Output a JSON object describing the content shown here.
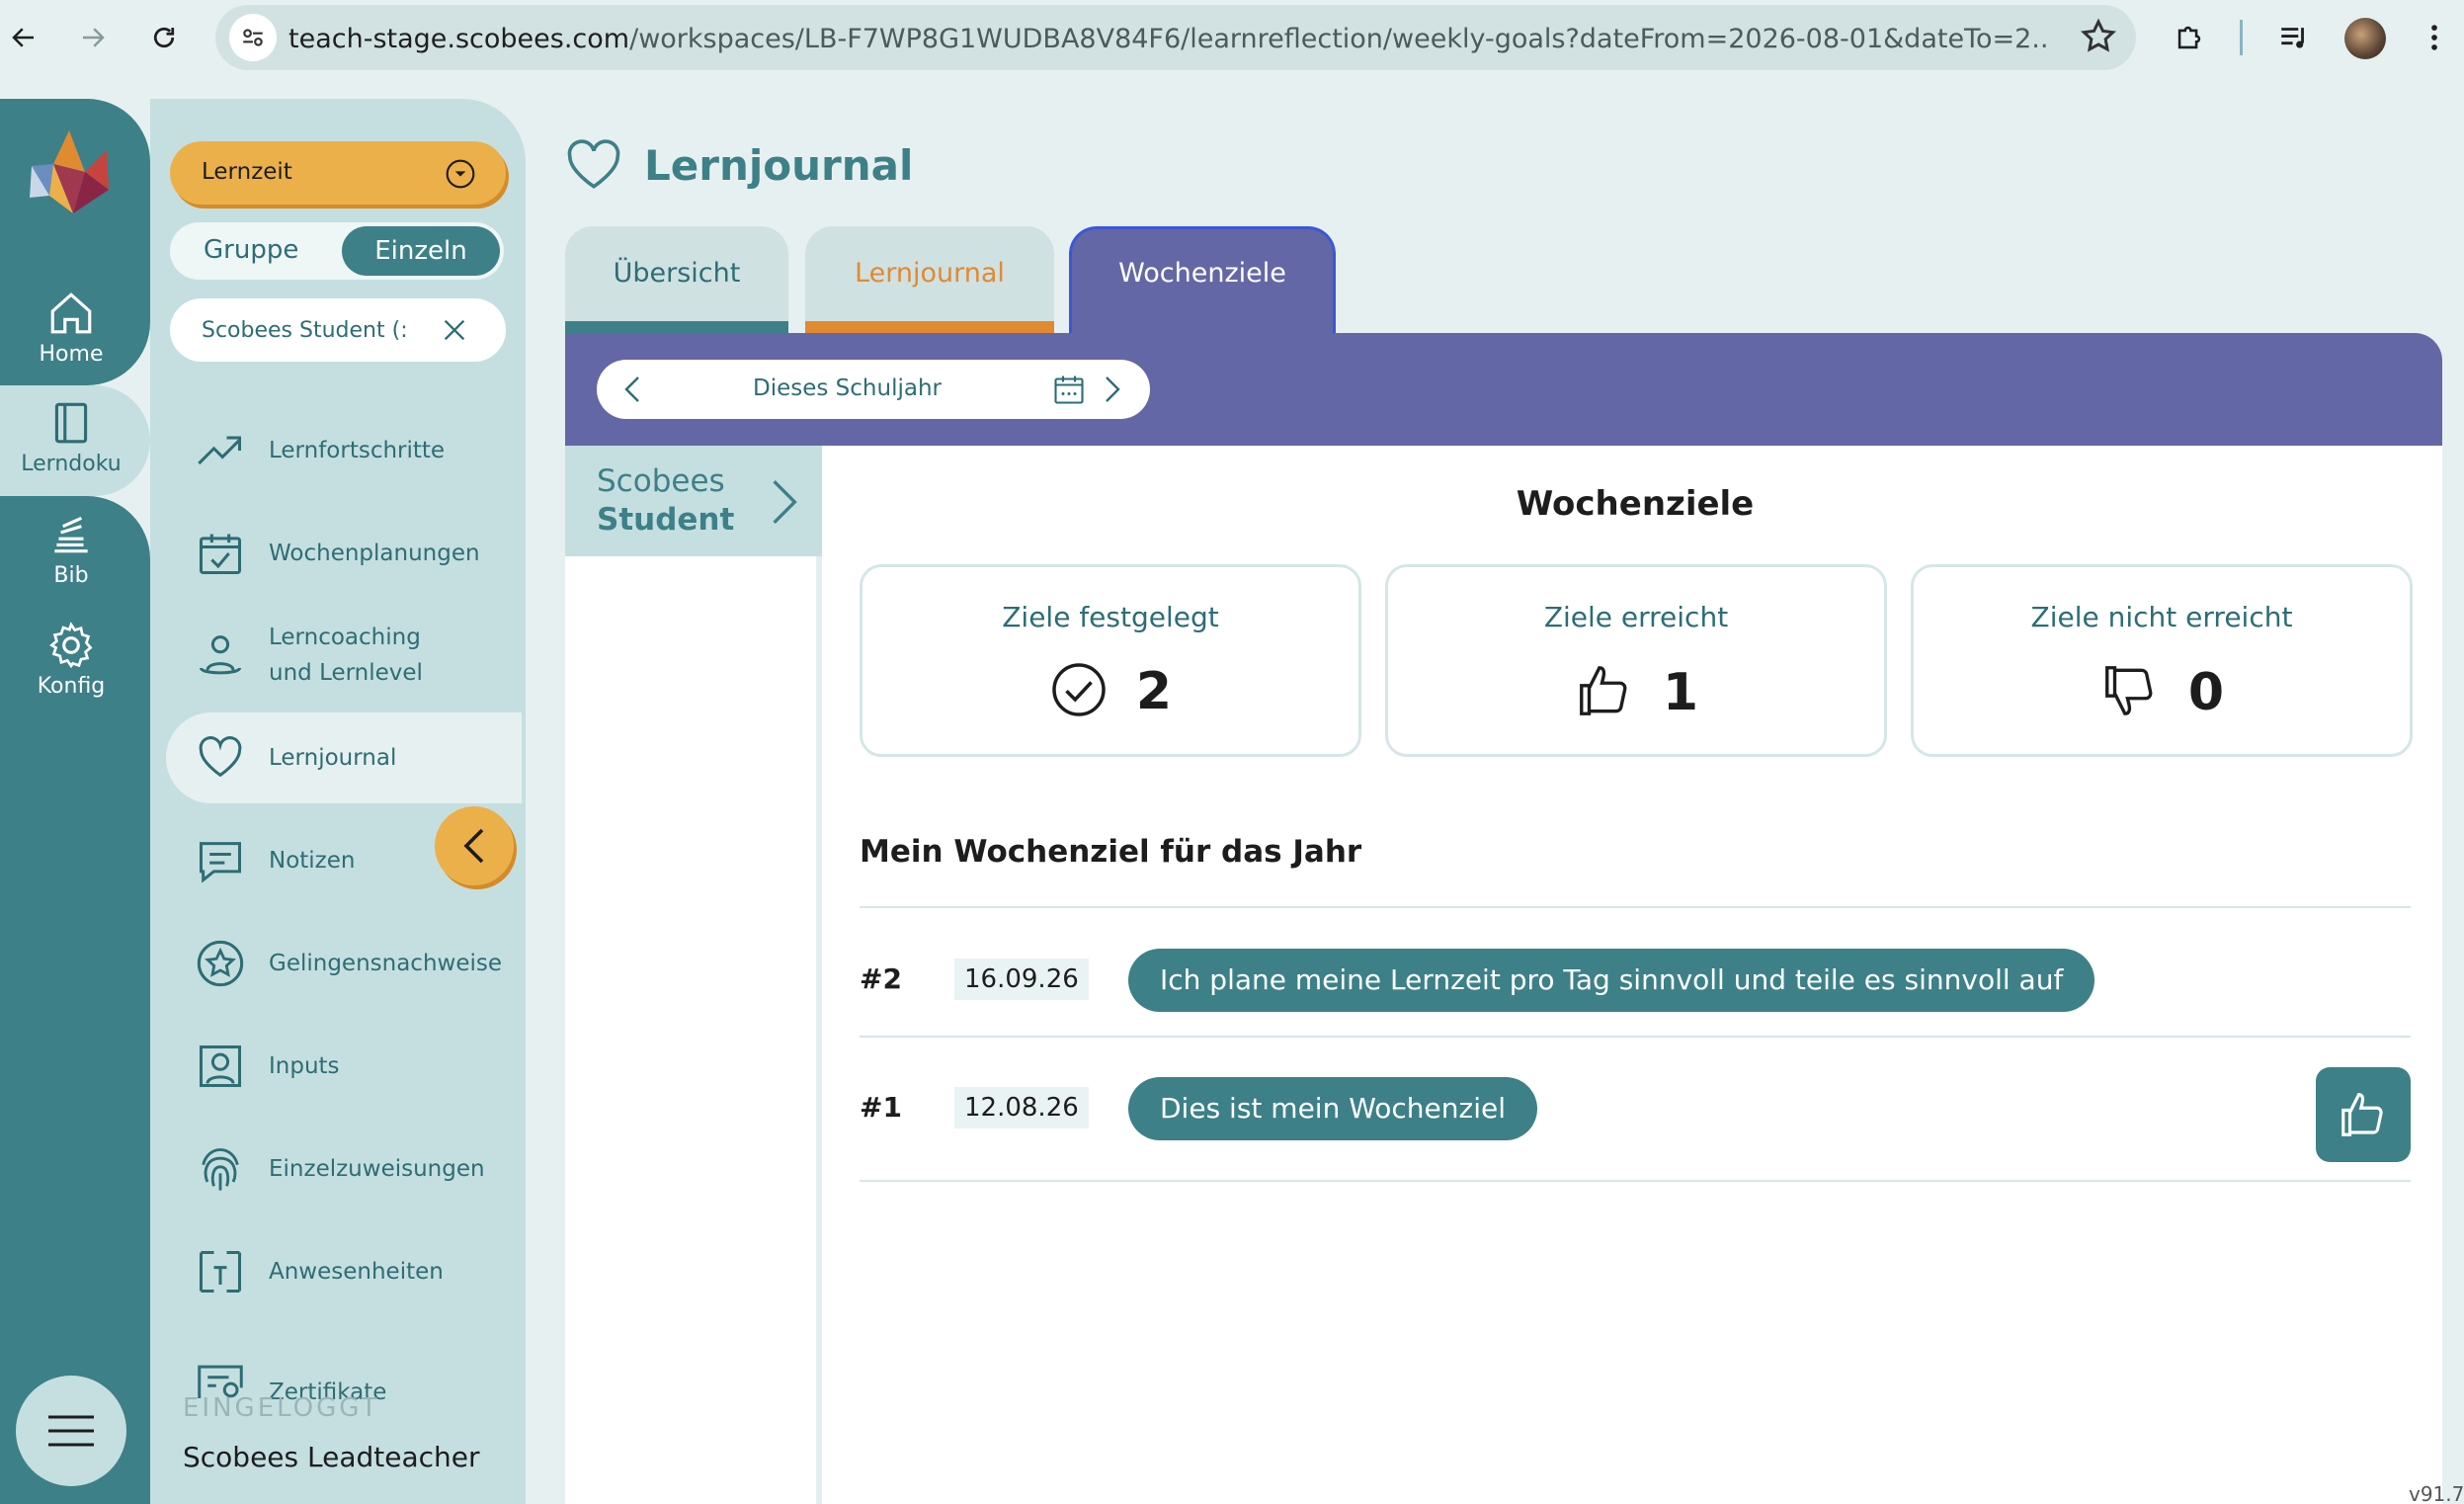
{
  "browser": {
    "url_host": "teach-stage.scobees.com",
    "url_path": "/workspaces/LB-F7WP8G1WUDBA8V84F6/learnreflection/weekly-goals?dateFrom=2026-08-01&dateTo=2..."
  },
  "rail": {
    "items": [
      {
        "label": "Home",
        "icon": "home-icon"
      },
      {
        "label": "Lerndoku",
        "icon": "notebook-icon"
      },
      {
        "label": "Bib",
        "icon": "library-icon"
      },
      {
        "label": "Konfig",
        "icon": "gear-icon"
      }
    ]
  },
  "sidebar": {
    "mode_select": "Lernzeit",
    "segment": {
      "group": "Gruppe",
      "single": "Einzeln"
    },
    "student_chip": "Scobees Student (:",
    "items": [
      {
        "label": "Lernfortschritte",
        "icon": "trend-icon"
      },
      {
        "label": "Wochenplanungen",
        "icon": "calendar-check-icon"
      },
      {
        "label": "Lerncoaching\nund Lernlevel",
        "label_1": "Lerncoaching",
        "label_2": "und Lernlevel",
        "icon": "person-icon"
      },
      {
        "label": "Lernjournal",
        "icon": "heart-icon"
      },
      {
        "label": "Notizen",
        "icon": "comment-icon"
      },
      {
        "label": "Gelingensnachweise",
        "icon": "star-badge-icon"
      },
      {
        "label": "Inputs",
        "icon": "person-frame-icon"
      },
      {
        "label": "Einzelzuweisungen",
        "icon": "fingerprint-icon"
      },
      {
        "label": "Anwesenheiten",
        "icon": "door-icon"
      },
      {
        "label": "Zertifikate",
        "icon": "certificate-icon"
      }
    ],
    "logged_in_label": "EINGELOGGT",
    "logged_in_user": "Scobees Leadteacher"
  },
  "main": {
    "title": "Lernjournal",
    "tabs": [
      "Übersicht",
      "Lernjournal",
      "Wochenziele"
    ],
    "active_tab": "Wochenziele",
    "date_range": "Dieses Schuljahr",
    "student_first": "Scobees",
    "student_last": "Student",
    "section_title": "Wochenziele",
    "stats": [
      {
        "label": "Ziele festgelegt",
        "value": "2",
        "icon": "check-circle-icon"
      },
      {
        "label": "Ziele erreicht",
        "value": "1",
        "icon": "thumbs-up-icon"
      },
      {
        "label": "Ziele nicht erreicht",
        "value": "0",
        "icon": "thumbs-down-icon"
      }
    ],
    "year_goals_title": "Mein Wochenziel für das Jahr",
    "goals": [
      {
        "number": "#2",
        "date": "16.09.26",
        "text": "Ich plane meine Lernzeit pro Tag sinnvoll und teile es sinnvoll auf"
      },
      {
        "number": "#1",
        "date": "12.08.26",
        "text": "Dies ist mein Wochenziel"
      }
    ]
  },
  "version": "v91.7",
  "colors": {
    "teal": "#3d8088",
    "purple": "#6467a6",
    "orange": "#ecb04a",
    "sidebar": "#c5dfe1"
  }
}
